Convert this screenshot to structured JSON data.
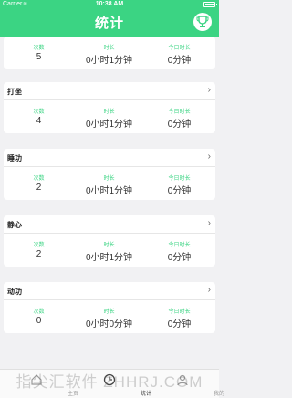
{
  "statusbar": {
    "carrier": "Carrier",
    "wifi": "≋",
    "time": "10:38 AM"
  },
  "navbar": {
    "title": "统计"
  },
  "labels": {
    "count": "次数",
    "duration": "时长",
    "today": "今日时长"
  },
  "chevron": "›",
  "cards": [
    {
      "category": "",
      "count": "5",
      "duration": "0小时1分钟",
      "today": "0分钟"
    },
    {
      "category": "打坐",
      "count": "4",
      "duration": "0小时1分钟",
      "today": "0分钟"
    },
    {
      "category": "睡功",
      "count": "2",
      "duration": "0小时1分钟",
      "today": "0分钟"
    },
    {
      "category": "静心",
      "count": "2",
      "duration": "0小时1分钟",
      "today": "0分钟"
    },
    {
      "category": "动功",
      "count": "0",
      "duration": "0小时0分钟",
      "today": "0分钟"
    }
  ],
  "tabs": [
    {
      "label": "主页",
      "icon": "home-icon"
    },
    {
      "label": "统计",
      "icon": "stats-clock-icon"
    },
    {
      "label": "我的",
      "icon": "profile-icon"
    }
  ],
  "watermark": "指尖汇软件 ZHHRJ.COM",
  "colors": {
    "accent": "#3bd483",
    "background": "#f1f1f3"
  }
}
